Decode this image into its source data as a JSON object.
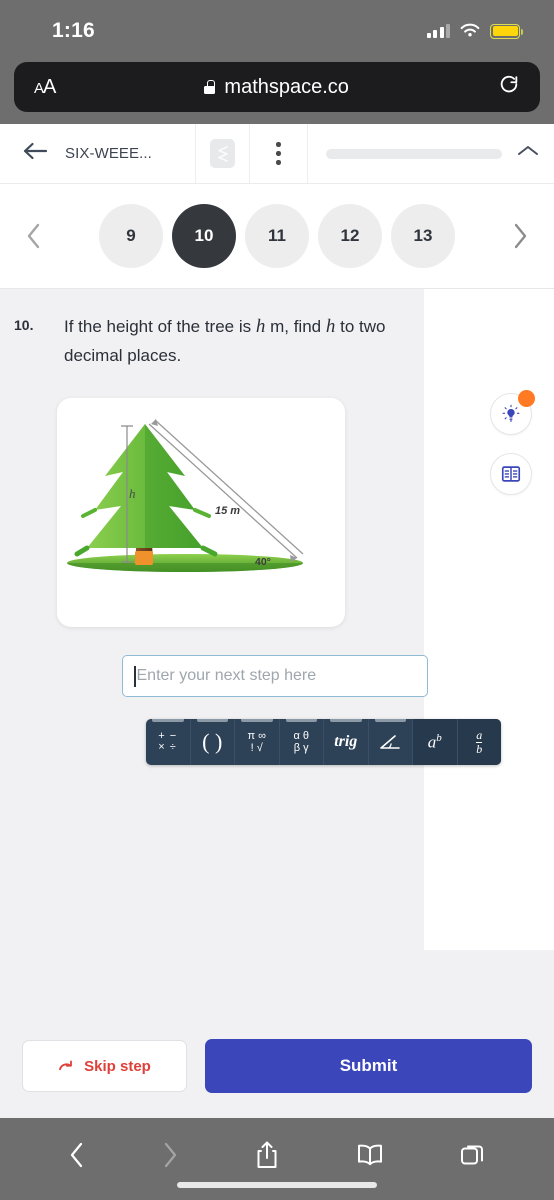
{
  "status_bar": {
    "time": "1:16",
    "signal_icon": "cellular-signal-icon",
    "wifi_icon": "wifi-icon",
    "battery_icon": "battery-icon",
    "battery_color": "#ffd60a"
  },
  "browser": {
    "text_size_label": "AA",
    "url": "mathspace.co",
    "lock_icon": "lock-icon",
    "reload_icon": "reload-icon",
    "bottom_bar": {
      "back_icon": "chevron-left-icon",
      "forward_icon": "chevron-right-icon",
      "share_icon": "share-icon",
      "bookmarks_icon": "book-icon",
      "tabs_icon": "tabs-icon"
    }
  },
  "app_header": {
    "back_icon": "arrow-left-icon",
    "course_title": "SIX-WEEE...",
    "logo_icon": "mathspace-logo-icon",
    "menu_icon": "more-vertical-icon",
    "progress_percent": 0,
    "collapse_icon": "chevron-up-icon"
  },
  "pager": {
    "prev_icon": "chevron-left-icon",
    "next_icon": "chevron-right-icon",
    "items": [
      {
        "label": "9",
        "active": false
      },
      {
        "label": "10",
        "active": true
      },
      {
        "label": "11",
        "active": false
      },
      {
        "label": "12",
        "active": false
      },
      {
        "label": "13",
        "active": false
      }
    ]
  },
  "question": {
    "number": "10.",
    "text_part1": "If the height of the tree is",
    "var1": "h",
    "text_part2": "m, find",
    "var2": "h",
    "text_part3": "to two decimal places."
  },
  "diagram": {
    "name": "tree-angle-of-elevation-diagram",
    "height_label": "h",
    "hypotenuse_label": "15 m",
    "angle_label": "40°",
    "colors": {
      "foliage_light": "#7ec544",
      "foliage_mid": "#4aa72e",
      "foliage_dark": "#2e8b23",
      "trunk": "#6b3d1c",
      "ground": "#5faa2a",
      "ground_light": "#8fd04a",
      "stump": "#f0922b"
    }
  },
  "answer_field": {
    "value": "",
    "placeholder": "Enter your next step here"
  },
  "math_toolbar": {
    "buttons": [
      {
        "name": "operators-button",
        "kind": "ops",
        "lines": [
          "+ −",
          "× ÷"
        ]
      },
      {
        "name": "parentheses-button",
        "kind": "paren",
        "label": "( )"
      },
      {
        "name": "symbols-button",
        "kind": "twocol",
        "lines": [
          "π ∞",
          "! √"
        ]
      },
      {
        "name": "greek-button",
        "kind": "twocol",
        "lines": [
          "α θ",
          "β γ"
        ]
      },
      {
        "name": "trig-button",
        "kind": "trig",
        "label": "trig"
      },
      {
        "name": "angle-button",
        "kind": "angle",
        "label": "∠"
      },
      {
        "name": "exponent-button",
        "kind": "pow",
        "base": "a",
        "exp": "b"
      },
      {
        "name": "fraction-button",
        "kind": "frac",
        "num": "a",
        "den": "b"
      }
    ]
  },
  "side_tools": [
    {
      "name": "hint-button",
      "icon": "lightbulb-icon",
      "badge": true
    },
    {
      "name": "worked-solution-button",
      "icon": "book-list-icon",
      "badge": false
    }
  ],
  "actions": {
    "skip_label": "Skip step",
    "skip_icon": "skip-arrow-icon",
    "skip_color": "#e0403a",
    "submit_label": "Submit",
    "submit_color": "#3b46ba"
  }
}
